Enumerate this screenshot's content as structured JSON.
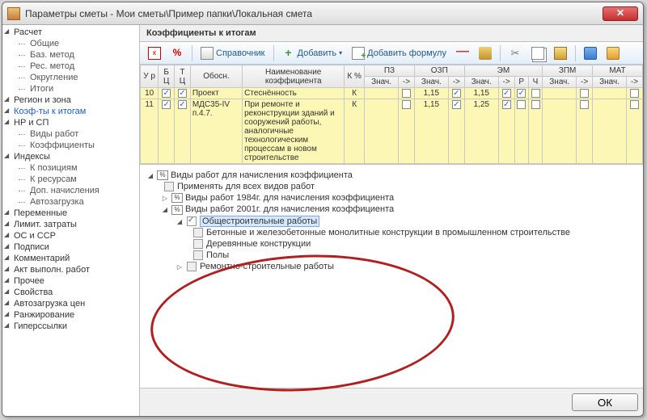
{
  "window": {
    "title": "Параметры сметы - Мои сметы\\Пример папки\\Локальная смета"
  },
  "nav": {
    "groups": [
      {
        "label": "Расчет",
        "children": [
          "Общие",
          "Баз. метод",
          "Рес. метод",
          "Округление",
          "Итоги"
        ]
      },
      {
        "label": "Регион и зона",
        "children": []
      },
      {
        "label": "Коэф-ты к итогам",
        "children": [],
        "selected": true
      },
      {
        "label": "НР и СП",
        "children": [
          "Виды работ",
          "Коэффициенты"
        ]
      },
      {
        "label": "Индексы",
        "children": [
          "К позициям",
          "К ресурсам",
          "Доп. начисления",
          "Автозагрузка"
        ]
      },
      {
        "label": "Переменные",
        "children": []
      },
      {
        "label": "Лимит. затраты",
        "children": []
      },
      {
        "label": "ОС и ССР",
        "children": []
      },
      {
        "label": "Подписи",
        "children": []
      },
      {
        "label": "Комментарий",
        "children": []
      },
      {
        "label": "Акт выполн. работ",
        "children": []
      },
      {
        "label": "Прочее",
        "children": []
      },
      {
        "label": "Свойства",
        "children": []
      },
      {
        "label": "Автозагрузка цен",
        "children": []
      },
      {
        "label": "Ранжирование",
        "children": []
      },
      {
        "label": "Гиперссылки",
        "children": []
      }
    ]
  },
  "panel": {
    "caption": "Коэффициенты к итогам"
  },
  "toolbar": {
    "k": "к",
    "pct": "%",
    "ref": "Справочник",
    "add": "Добавить",
    "addf": "Добавить формулу"
  },
  "grid": {
    "head1": {
      "ur": "У р",
      "bc": "Б Ц",
      "tc": "Т Ц",
      "obosn": "Обосн.",
      "name": "Наименование коэффициента",
      "kpct": "К %",
      "pz": "ПЗ",
      "ozp": "ОЗП",
      "em": "ЭМ",
      "zpm": "ЗПМ",
      "mat": "МАТ"
    },
    "head2": {
      "znach": "Знач.",
      "arrow": "->",
      "r": "Р",
      "ch": "Ч"
    },
    "rows": [
      {
        "n": "10",
        "obosn": "Проект",
        "name": "Стеснённость",
        "k": "К",
        "ozp_v": "1,15",
        "ozp_c": true,
        "em_v": "1,15",
        "em_c": true,
        "em_r": true
      },
      {
        "n": "11",
        "obosn": "МДС35-IV п.4.7.",
        "name": "При ремонте и реконструкции зданий и сооружений работы, аналогичные технологическим процессам в новом строительстве",
        "k": "К",
        "ozp_v": "1,15",
        "ozp_c": true,
        "em_v": "1,25",
        "em_c": true
      }
    ]
  },
  "tree": {
    "root": "Виды работ для начисления коэффициента",
    "n1": "Применять для всех видов работ",
    "n2": "Виды работ 1984г. для начисления коэффициента",
    "n3": "Виды работ 2001г. для начисления коэффициента",
    "n3a": "Общестроительные работы",
    "n3a1": "Бетонные и железобетонные монолитные конструкции в промышленном строительстве",
    "n3a2": "Деревянные конструкции",
    "n3a3": "Полы",
    "n3b": "Ремонтно-строительные работы"
  },
  "footer": {
    "ok": "ОК"
  }
}
